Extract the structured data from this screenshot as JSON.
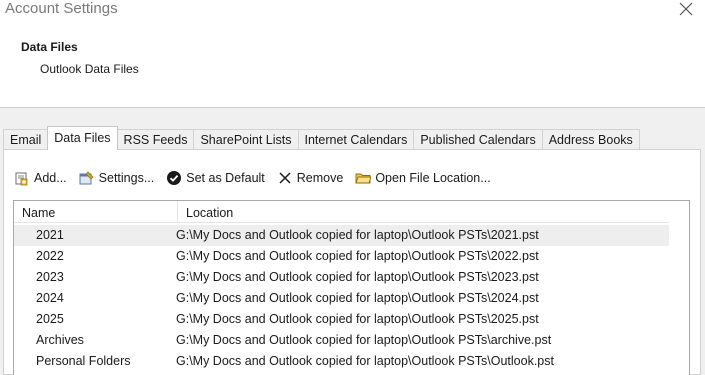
{
  "window": {
    "title": "Account Settings"
  },
  "header": {
    "title": "Data Files",
    "subtitle": "Outlook Data Files"
  },
  "tabs": [
    {
      "label": "Email",
      "active": false
    },
    {
      "label": "Data Files",
      "active": true
    },
    {
      "label": "RSS Feeds",
      "active": false
    },
    {
      "label": "SharePoint Lists",
      "active": false
    },
    {
      "label": "Internet Calendars",
      "active": false
    },
    {
      "label": "Published Calendars",
      "active": false
    },
    {
      "label": "Address Books",
      "active": false
    }
  ],
  "toolbar": {
    "add_label": "Add...",
    "settings_label": "Settings...",
    "set_default_label": "Set as Default",
    "remove_label": "Remove",
    "open_location_label": "Open File Location..."
  },
  "list": {
    "columns": {
      "name": "Name",
      "location": "Location"
    },
    "rows": [
      {
        "name": "2021",
        "location": "G:\\My Docs and Outlook copied for laptop\\Outlook PSTs\\2021.pst",
        "selected": true
      },
      {
        "name": "2022",
        "location": "G:\\My Docs and Outlook copied for laptop\\Outlook PSTs\\2022.pst",
        "selected": false
      },
      {
        "name": "2023",
        "location": "G:\\My Docs and Outlook copied for laptop\\Outlook PSTs\\2023.pst",
        "selected": false
      },
      {
        "name": "2024",
        "location": "G:\\My Docs and Outlook copied for laptop\\Outlook PSTs\\2024.pst",
        "selected": false
      },
      {
        "name": "2025",
        "location": "G:\\My Docs and Outlook copied for laptop\\Outlook PSTs\\2025.pst",
        "selected": false
      },
      {
        "name": "Archives",
        "location": "G:\\My Docs and Outlook copied for laptop\\Outlook PSTs\\archive.pst",
        "selected": false
      },
      {
        "name": "Personal Folders",
        "location": "G:\\My Docs and Outlook copied for laptop\\Outlook PSTs\\Outlook.pst",
        "selected": false
      }
    ]
  },
  "icons": {
    "close": "close-icon",
    "add": "add-datafile-icon",
    "settings": "settings-icon",
    "set_default": "checkmark-circle-icon",
    "remove": "x-icon",
    "open_location": "folder-icon"
  }
}
